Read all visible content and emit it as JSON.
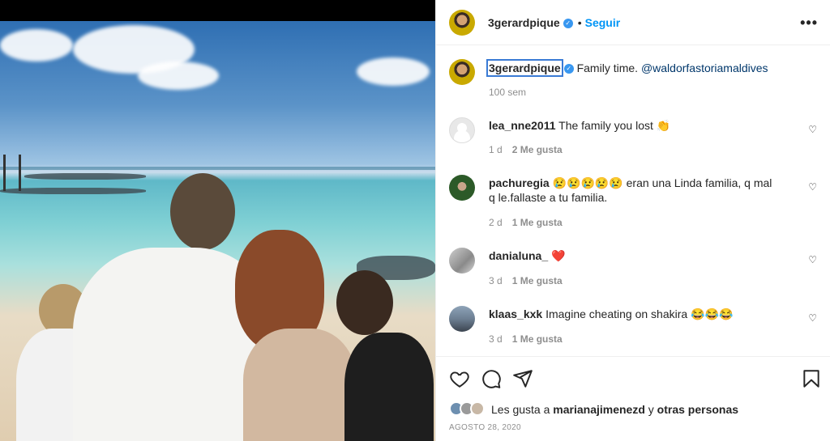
{
  "post": {
    "username": "3gerardpique",
    "follow_label": "Seguir",
    "dot": "•",
    "more_label": "•••",
    "caption": "Family time.",
    "caption_mention": "@waldorfastoriamaldives",
    "caption_time": "100 sem"
  },
  "comments": [
    {
      "username": "lea_nne2011",
      "text": "The family you lost 👏",
      "time": "1 d",
      "likes": "2 Me gusta"
    },
    {
      "username": "pachuregia",
      "text": "😢😢😢😢😢 eran una Linda familia, q mal q le.fallaste a tu familia.",
      "time": "2 d",
      "likes": "1 Me gusta"
    },
    {
      "username": "danialuna_",
      "text": "❤️",
      "time": "3 d",
      "likes": "1 Me gusta"
    },
    {
      "username": "klaas_kxk",
      "text": "Imagine cheating on shakira 😂😂😂",
      "time": "3 d",
      "likes": "1 Me gusta"
    }
  ],
  "likes": {
    "prefix": "Les gusta a",
    "user": "marianajimenezd",
    "and": "y",
    "others": "otras personas"
  },
  "date": "AGOSTO 28, 2020",
  "colors": {
    "link": "#0095f6",
    "mention": "#00376b",
    "muted": "#8e8e8e"
  },
  "icons": [
    "like-heart-icon",
    "comment-icon",
    "share-icon",
    "save-icon",
    "verified-badge-icon",
    "more-options-icon"
  ]
}
